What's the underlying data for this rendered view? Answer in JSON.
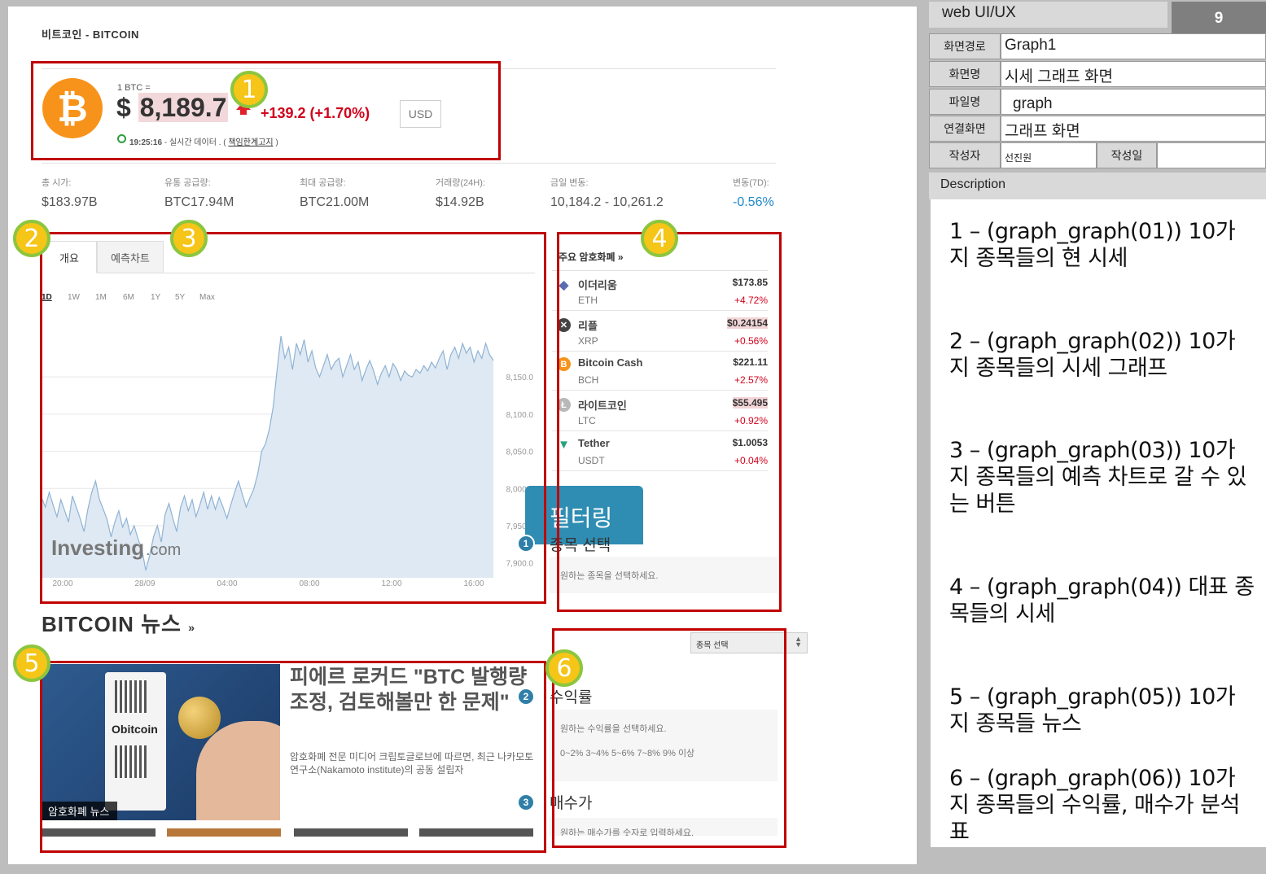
{
  "page": {
    "breadcrumb": "비트코인 - BITCOIN",
    "unit_label": "1 BTC =",
    "price_currency": "$",
    "price_value": "8,189.7",
    "change": "+139.2  (+1.70%)",
    "currency_button": "USD",
    "time_info_time": "19:25:16",
    "time_info_text": " - 실시간 데이터 . ( ",
    "time_info_link": "책임한계고지",
    "time_info_end": " )",
    "stats": [
      {
        "label": "총 시가:",
        "value": "$183.97B"
      },
      {
        "label": "유통 공급량:",
        "value": "BTC17.94M"
      },
      {
        "label": "최대 공급량:",
        "value": "BTC21.00M"
      },
      {
        "label": "거래량(24H):",
        "value": "$14.92B"
      },
      {
        "label": "금일 변동:",
        "value": "10,184.2 - 10,261.2"
      },
      {
        "label": "변동(7D):",
        "value": "-0.56%"
      }
    ],
    "tabs": [
      "개요",
      "예측차트"
    ],
    "ranges": [
      "1D",
      "1W",
      "1M",
      "6M",
      "1Y",
      "5Y",
      "Max"
    ],
    "chart_watermark": "Investing",
    "chart_watermark_suffix": ".com",
    "crypto_header": "주요 암호화폐 »",
    "cryptos": [
      {
        "name": "이더리움",
        "symbol": "ETH",
        "price": "$173.85",
        "change": "+4.72%",
        "icon": "ethereum-icon",
        "color": "#5b6bb0"
      },
      {
        "name": "리플",
        "symbol": "XRP",
        "price": "$0.24154",
        "change": "+0.56%",
        "icon": "ripple-icon",
        "color": "#444444"
      },
      {
        "name": "Bitcoin Cash",
        "symbol": "BCH",
        "price": "$221.11",
        "change": "+2.57%",
        "icon": "bitcoin-cash-icon",
        "color": "#f7931a"
      },
      {
        "name": "라이트코인",
        "symbol": "LTC",
        "price": "$55.495",
        "change": "+0.92%",
        "icon": "litecoin-icon",
        "color": "#b8b8b8"
      },
      {
        "name": "Tether",
        "symbol": "USDT",
        "price": "$1.0053",
        "change": "+0.04%",
        "icon": "tether-icon",
        "color": "#26a17b"
      }
    ],
    "filter_tab": "필터링",
    "select_label": "종목 선택",
    "select_hint": "원하는 종목을 선택하세요.",
    "news_title": "BITCOIN 뉴스",
    "news_chev": "»",
    "news_headline": "피에르 로커드 \"BTC 발행량 조정, 검토해볼만 한 문제\"",
    "news_snippet": "암호화폐 전문 미디어 크립토글로브에 따르면, 최근 나카모토 연구소(Nakamoto institute)의 공동 설립자",
    "news_img_caption": "암호화폐 뉴스",
    "news_img_brand": "Obitcoin",
    "combo_value": "종목 선택",
    "yield_label": "수익률",
    "yield_hint": "원하는 수익률을 선택하세요.",
    "yield_options": "0~2% 3~4% 5~6% 7~8% 9% 이상",
    "buy_label": "매수가",
    "buy_hint": "원하는 매수가를 숫자로 입력하세요.",
    "badges": [
      "1",
      "2",
      "3"
    ],
    "markers": [
      "1",
      "2",
      "3",
      "4",
      "5",
      "6"
    ]
  },
  "spec": {
    "app": "web UI/UX",
    "page_no": "9",
    "rows": [
      {
        "label": "화면경로",
        "value": "Graph1"
      },
      {
        "label": "화면명",
        "value": "시세 그래프 화면"
      },
      {
        "label": "파일명",
        "value": "graph"
      },
      {
        "label": "연결화면",
        "value": "그래프 화면"
      }
    ],
    "author_label": "작성자",
    "author": "선진원",
    "date_label": "작성일",
    "date": "",
    "desc_header": "Description",
    "descriptions": [
      "1 – (graph_graph(01)) 10가지 종목들의 현 시세",
      "2 – (graph_graph(02)) 10가지 종목들의 시세 그래프",
      "3 – (graph_graph(03)) 10가지 종목들의 예측 차트로 갈 수 있는 버튼",
      "4 – (graph_graph(04)) 대표 종목들의 시세",
      "5 – (graph_graph(05)) 10가지 종목들 뉴스",
      "6 – (graph_graph(06)) 10가지 종목들의 수익률, 매수가 분석표"
    ]
  },
  "chart_data": {
    "type": "area",
    "x_ticks": [
      "20:00",
      "28/09",
      "04:00",
      "08:00",
      "12:00",
      "16:00"
    ],
    "y_ticks": [
      8150.0,
      8100.0,
      8050.0,
      8000.0,
      7950.0,
      7900.0
    ],
    "ylim": [
      7880,
      8230
    ],
    "series": [
      {
        "values": [
          7988,
          7975,
          7995,
          7978,
          7962,
          7985,
          7970,
          7955,
          7990,
          7975,
          7960,
          7942,
          7972,
          7995,
          8010,
          7985,
          7972,
          7958,
          7935,
          7955,
          7970,
          7948,
          7960,
          7938,
          7950,
          7932,
          7918,
          7890,
          7910,
          7935,
          7950,
          7928,
          7965,
          7980,
          7960,
          7942,
          7975,
          7990,
          7970,
          7985,
          7962,
          7978,
          7995,
          7972,
          7990,
          7972,
          7988,
          7975,
          7960,
          7978,
          7995,
          8010,
          7992,
          7975,
          7988,
          8000,
          8020,
          8050,
          8060,
          8080,
          8110,
          8160,
          8205,
          8175,
          8190,
          8160,
          8195,
          8180,
          8200,
          8170,
          8185,
          8162,
          8150,
          8165,
          8180,
          8160,
          8170,
          8175,
          8150,
          8165,
          8180,
          8160,
          8170,
          8145,
          8160,
          8172,
          8158,
          8140,
          8155,
          8165,
          8150,
          8168,
          8160,
          8145,
          8158,
          8152,
          8150,
          8160,
          8155,
          8165,
          8158,
          8170,
          8162,
          8175,
          8185,
          8160,
          8180,
          8190,
          8175,
          8195,
          8182,
          8190,
          8170,
          8185,
          8175,
          8195,
          8180,
          8172
        ]
      }
    ]
  }
}
